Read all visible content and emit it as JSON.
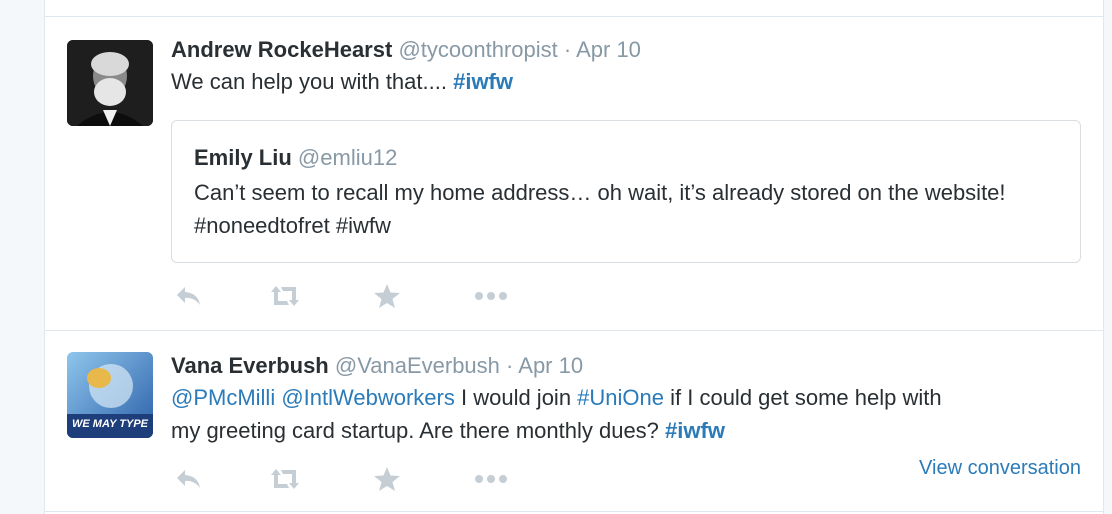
{
  "tweets": [
    {
      "fullname": "Andrew RockeHearst",
      "username": "@tycoonthropist",
      "dot": "·",
      "time": "Apr 10",
      "text_plain": "We can help you with that.... ",
      "hashtag": "#iwfw",
      "quoted": {
        "fullname": "Emily Liu",
        "username": "@emliu12",
        "text": "Can’t seem to recall my home address… oh wait, it’s already stored on the website! #noneedtofret #iwfw"
      }
    },
    {
      "fullname": "Vana Everbush",
      "username": "@VanaEverbush",
      "dot": "·",
      "time": "Apr 10",
      "mention1": "@PMcMilli",
      "mention2": "@IntlWebworkers",
      "text1": " I would join ",
      "hashtag1": "#UniOne",
      "text2": " if I could get some help with",
      "text3": "my greeting card startup. Are there monthly dues? ",
      "hashtag2": "#iwfw",
      "avatar_text": "WE MAY TYPE",
      "view_conversation": "View conversation"
    }
  ],
  "icons": [
    "reply-icon",
    "retweet-icon",
    "favorite-icon",
    "more-icon"
  ],
  "colors": {
    "link": "#2b7bb9",
    "muted": "#8899a6",
    "action_icon": "#c5ced5",
    "border": "#e1e8ed"
  }
}
